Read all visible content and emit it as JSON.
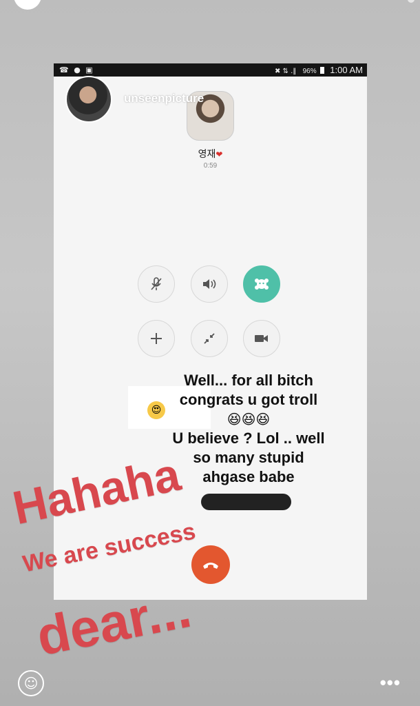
{
  "status_bar": {
    "left_icons": "☎ ● ▣",
    "signal_icons": "✖ ⇅ .‖",
    "battery": "96%",
    "time": "1:00 AM"
  },
  "story": {
    "username": "unseenpicture",
    "avatar_icon": "profile-avatar-icon"
  },
  "call": {
    "caller_name": "영재",
    "caller_heart": "❤",
    "timer": "0:59",
    "controls_row1": [
      {
        "name": "mute-icon",
        "glyph": "🎙"
      },
      {
        "name": "speaker-icon",
        "glyph": "🔊"
      },
      {
        "name": "sticker-icon",
        "glyph": "✿"
      }
    ],
    "controls_row2": [
      {
        "name": "add-icon",
        "glyph": "+"
      },
      {
        "name": "minimize-icon",
        "glyph": "⤡"
      },
      {
        "name": "video-icon",
        "glyph": "■"
      }
    ],
    "end_call_icon": "end-call-icon",
    "accent_color": "#4fc0a8",
    "end_call_color": "#e3572f"
  },
  "message": {
    "line1": "Well... for all bitch",
    "line2": "congrats u got troll",
    "laughs": "😆😆😆",
    "line3": "U believe ? Lol .. well",
    "line4": "so many stupid",
    "line5": "ahgase babe",
    "sticker_emoji": "😍"
  },
  "handwriting": {
    "line1": "Hahaha",
    "line2": "We are success",
    "line3": "dear...",
    "color": "#d8484e"
  },
  "footer": {
    "smile_glyph": "☺",
    "more_glyph": "•••"
  }
}
